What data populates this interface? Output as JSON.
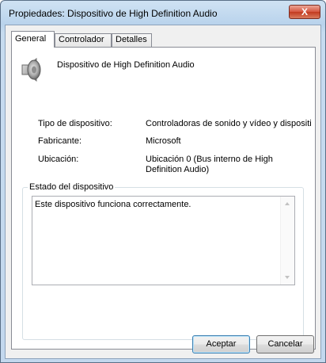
{
  "window": {
    "title": "Propiedades: Dispositivo de High Definition Audio",
    "close_label": "X"
  },
  "tabs": [
    {
      "label": "General",
      "active": true
    },
    {
      "label": "Controlador",
      "active": false
    },
    {
      "label": "Detalles",
      "active": false
    }
  ],
  "device": {
    "icon": "speaker-icon",
    "name": "Dispositivo de High Definition Audio"
  },
  "properties": [
    {
      "label": "Tipo de dispositivo:",
      "value": "Controladoras de sonido y vídeo y dispositi"
    },
    {
      "label": "Fabricante:",
      "value": "Microsoft"
    },
    {
      "label": "Ubicación:",
      "value_line1": "Ubicación 0 (Bus interno de High",
      "value_line2": "Definition Audio)"
    }
  ],
  "status": {
    "group_label": "Estado del dispositivo",
    "text": "Este dispositivo funciona correctamente."
  },
  "buttons": {
    "accept": "Aceptar",
    "cancel": "Cancelar"
  }
}
